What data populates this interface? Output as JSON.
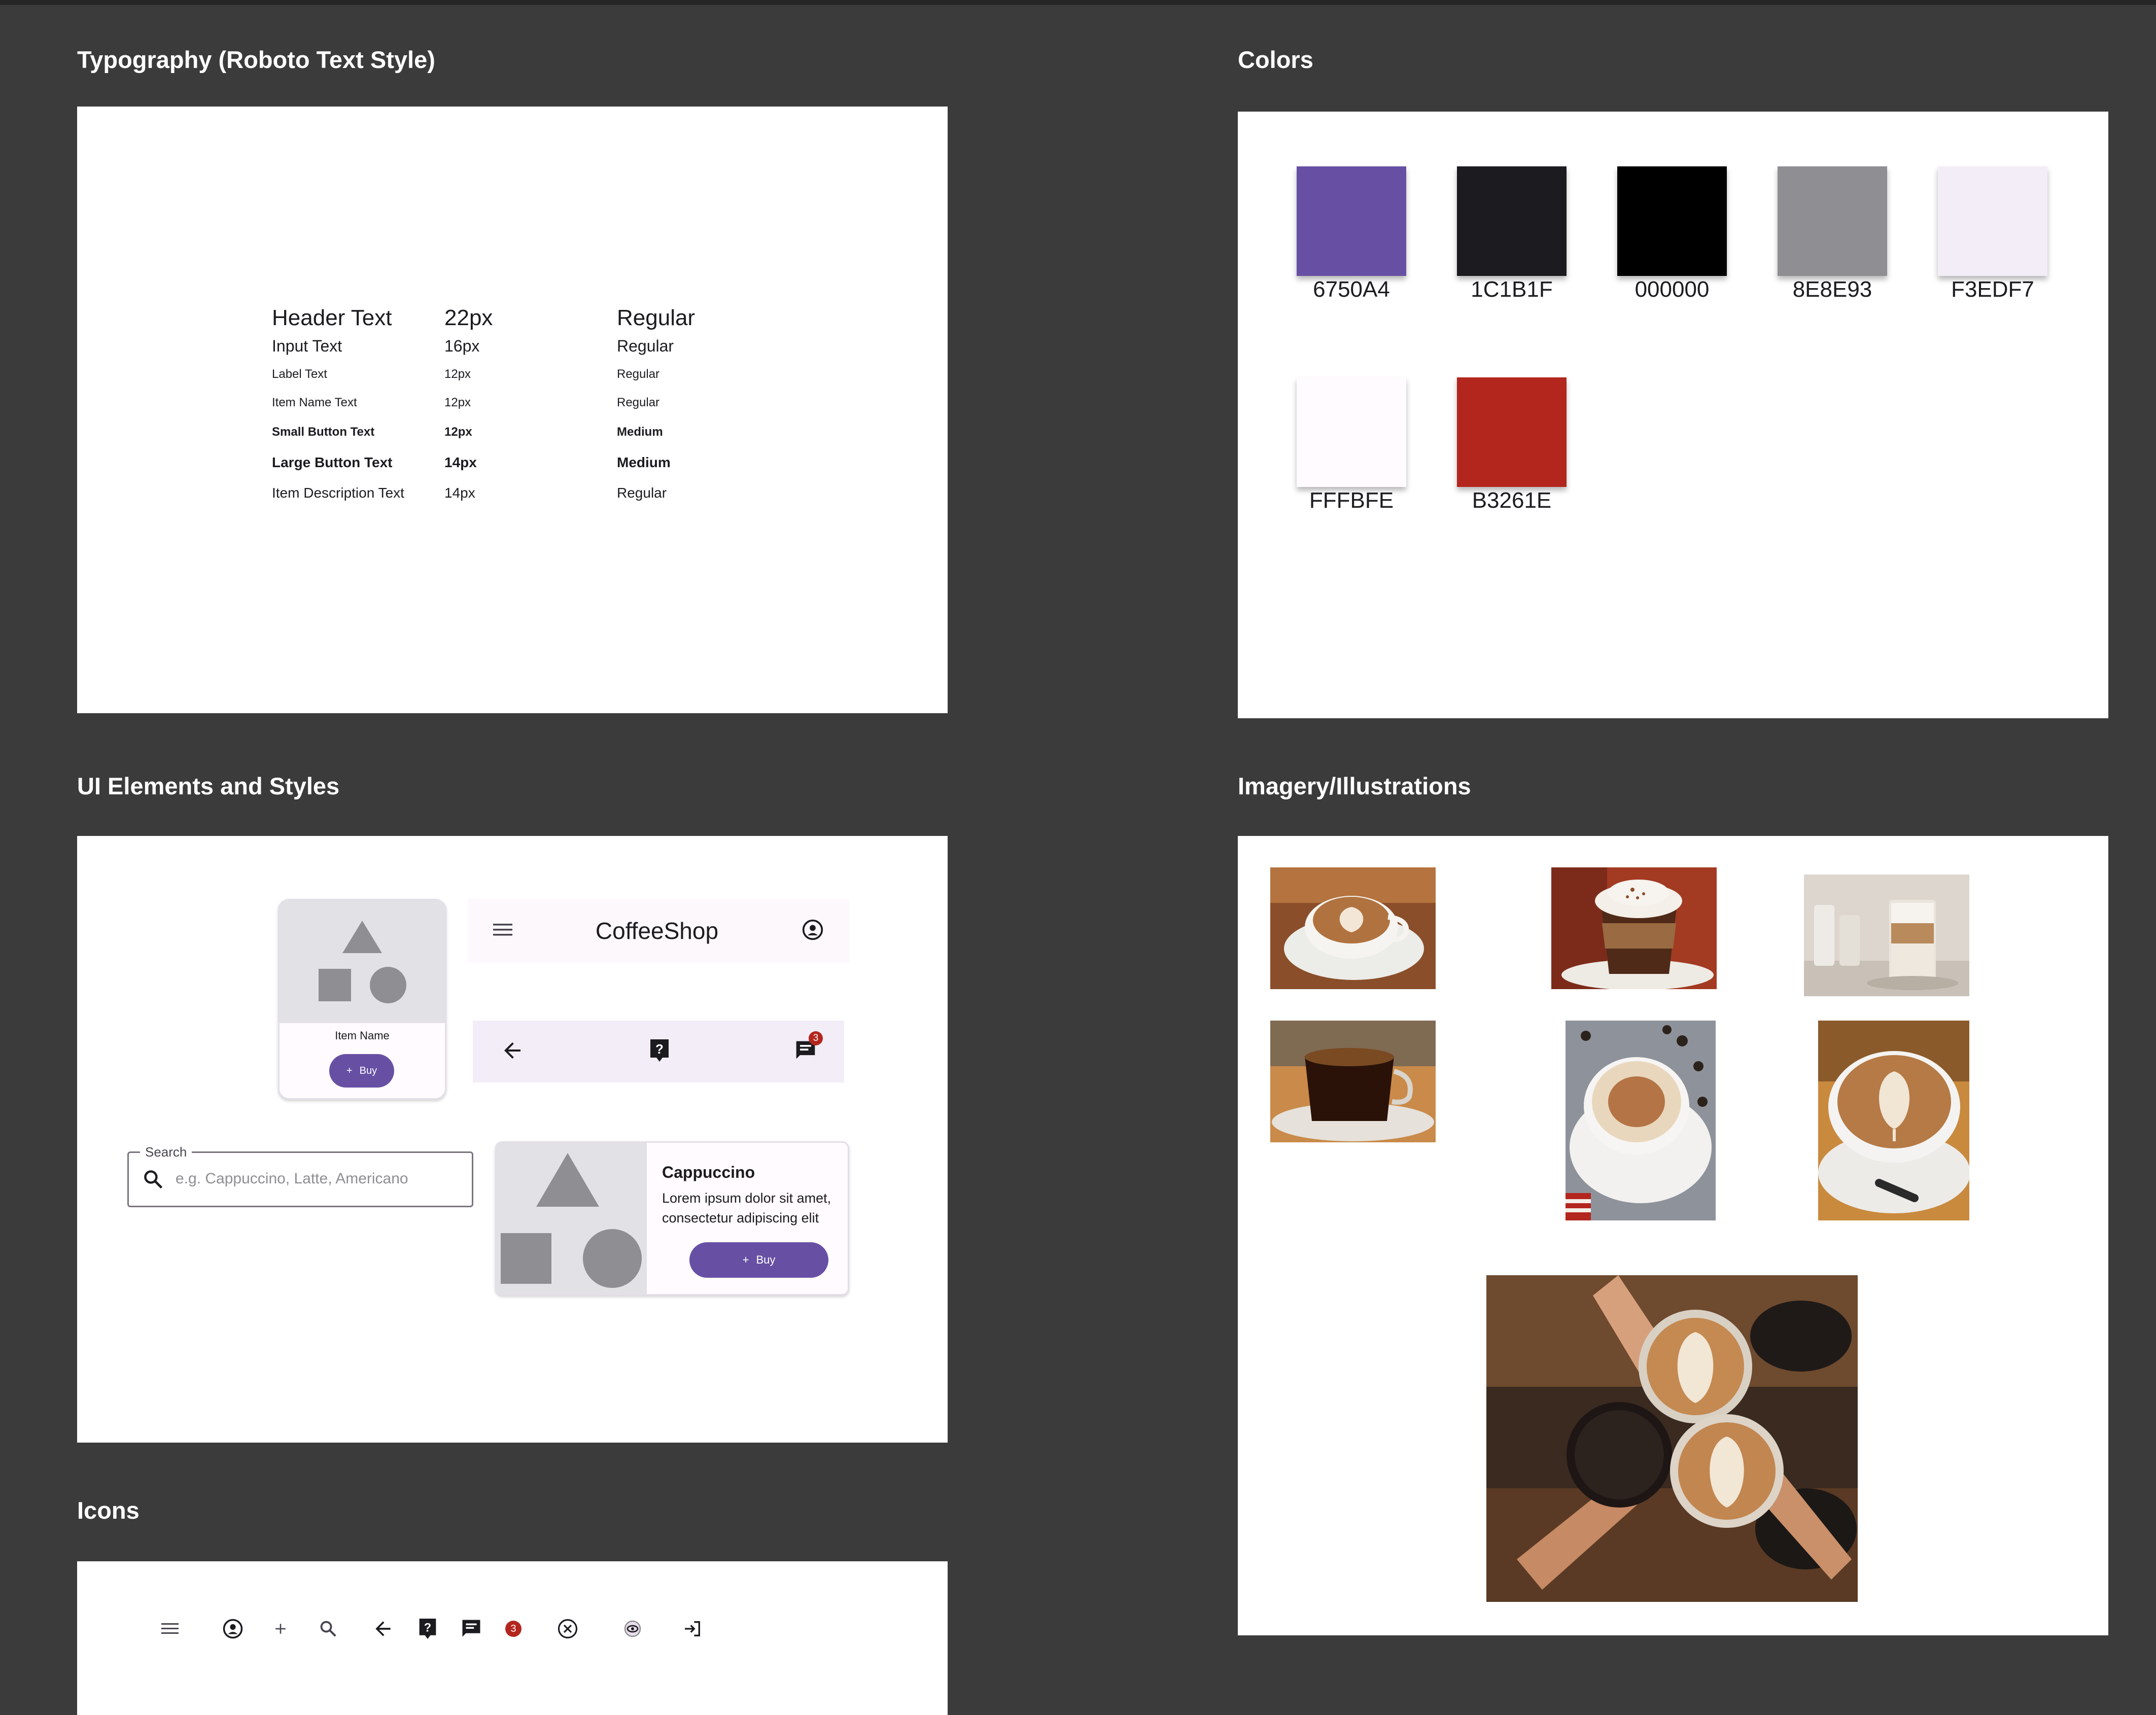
{
  "sections": {
    "typography": "Typography (Roboto Text Style)",
    "colors": "Colors",
    "ui_elements": "UI Elements and Styles",
    "imagery": "Imagery/Illustrations",
    "icons": "Icons"
  },
  "typography": {
    "rows": [
      {
        "name": "Header Text",
        "size": "22px",
        "weight": "Regular"
      },
      {
        "name": "Input Text",
        "size": "16px",
        "weight": "Regular"
      },
      {
        "name": "Label Text",
        "size": "12px",
        "weight": "Regular"
      },
      {
        "name": "Item Name Text",
        "size": "12px",
        "weight": "Regular"
      },
      {
        "name": "Small Button Text",
        "size": "12px",
        "weight": "Medium"
      },
      {
        "name": "Large Button Text",
        "size": "14px",
        "weight": "Medium"
      },
      {
        "name": "Item Description Text",
        "size": "14px",
        "weight": "Regular"
      }
    ]
  },
  "colors": {
    "swatches": [
      {
        "label": "6750A4",
        "hex": "#6750A4"
      },
      {
        "label": "1C1B1F",
        "hex": "#1C1B1F"
      },
      {
        "label": "000000",
        "hex": "#000000"
      },
      {
        "label": "8E8E93",
        "hex": "#8E8E93"
      },
      {
        "label": "F3EDF7",
        "hex": "#F3EDF7"
      },
      {
        "label": "FFFBFE",
        "hex": "#FFFBFE"
      },
      {
        "label": "B3261E",
        "hex": "#B3261E"
      }
    ]
  },
  "ui": {
    "item_card": {
      "name": "Item Name",
      "button": "Buy"
    },
    "top_app_bar": {
      "title": "CoffeeShop",
      "menu_icon": "menu-icon",
      "account_icon": "account-circle-icon"
    },
    "bottom_bar": {
      "icons": [
        "arrow-back-icon",
        "help-icon",
        "chat-icon"
      ],
      "badge": "3"
    },
    "search": {
      "label": "Search",
      "placeholder": "e.g. Cappuccino, Latte, Americano"
    },
    "product_card": {
      "title": "Cappuccino",
      "description": "Lorem ipsum dolor sit amet, consectetur adipiscing elit",
      "button": "Buy"
    }
  },
  "icons": {
    "items": [
      "menu-icon",
      "account-circle-icon",
      "add-icon",
      "search-icon",
      "arrow-back-icon",
      "help-icon",
      "chat-icon",
      "notification-badge-icon",
      "cancel-icon",
      "eye-icon",
      "login-icon"
    ],
    "badge_number": "3"
  },
  "imagery": {
    "photos": [
      "latte-art-cup-photo",
      "whipped-cream-mocha-photo",
      "latte-glass-photo",
      "black-coffee-photo",
      "cappuccino-beans-photo",
      "latte-art-spoon-photo",
      "three-cups-cheers-photo"
    ]
  },
  "accent": {
    "primary": "#6750A4",
    "badge": "#B3261E",
    "placeholder_gray": "#8E8E93"
  }
}
